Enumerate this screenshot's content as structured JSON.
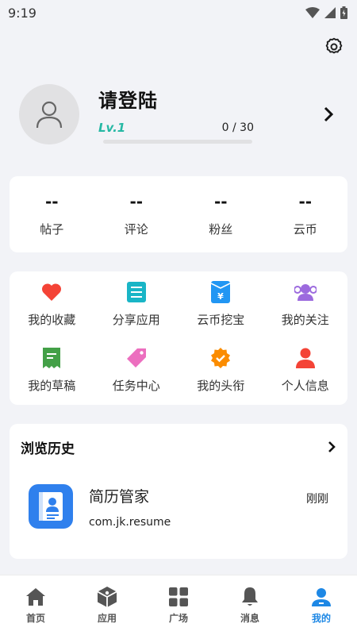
{
  "status_bar": {
    "time": "9:19"
  },
  "profile": {
    "name": "请登陆",
    "level": "Lv.1",
    "exp_text": "0 / 30",
    "progress": 0
  },
  "stats": [
    {
      "value": "--",
      "label": "帖子"
    },
    {
      "value": "--",
      "label": "评论"
    },
    {
      "value": "--",
      "label": "粉丝"
    },
    {
      "value": "--",
      "label": "云币"
    }
  ],
  "grid": [
    {
      "label": "我的收藏",
      "icon": "heart-icon",
      "color": "#f44336"
    },
    {
      "label": "分享应用",
      "icon": "list-icon",
      "color": "#19b5c6"
    },
    {
      "label": "云币挖宝",
      "icon": "treasure-icon",
      "color": "#2196f3"
    },
    {
      "label": "我的关注",
      "icon": "users-icon",
      "color": "#9c6ade"
    },
    {
      "label": "我的草稿",
      "icon": "draft-icon",
      "color": "#43a047"
    },
    {
      "label": "任务中心",
      "icon": "tag-icon",
      "color": "#ec6fbf"
    },
    {
      "label": "我的头衔",
      "icon": "badge-icon",
      "color": "#fb8c00"
    },
    {
      "label": "个人信息",
      "icon": "person-icon",
      "color": "#f44336"
    }
  ],
  "history": {
    "title": "浏览历史",
    "items": [
      {
        "name": "简历管家",
        "package": "com.jk.resume",
        "time": "刚刚",
        "icon": "resume-app-icon"
      }
    ]
  },
  "nav": [
    {
      "label": "首页",
      "icon": "home-icon"
    },
    {
      "label": "应用",
      "icon": "apps-cube-icon"
    },
    {
      "label": "广场",
      "icon": "square-grid-icon"
    },
    {
      "label": "消息",
      "icon": "bell-icon"
    },
    {
      "label": "我的",
      "icon": "me-icon",
      "active": true
    }
  ],
  "colors": {
    "accent": "#1e88e5",
    "level": "#26b8a4",
    "background": "#f2f3f7"
  }
}
